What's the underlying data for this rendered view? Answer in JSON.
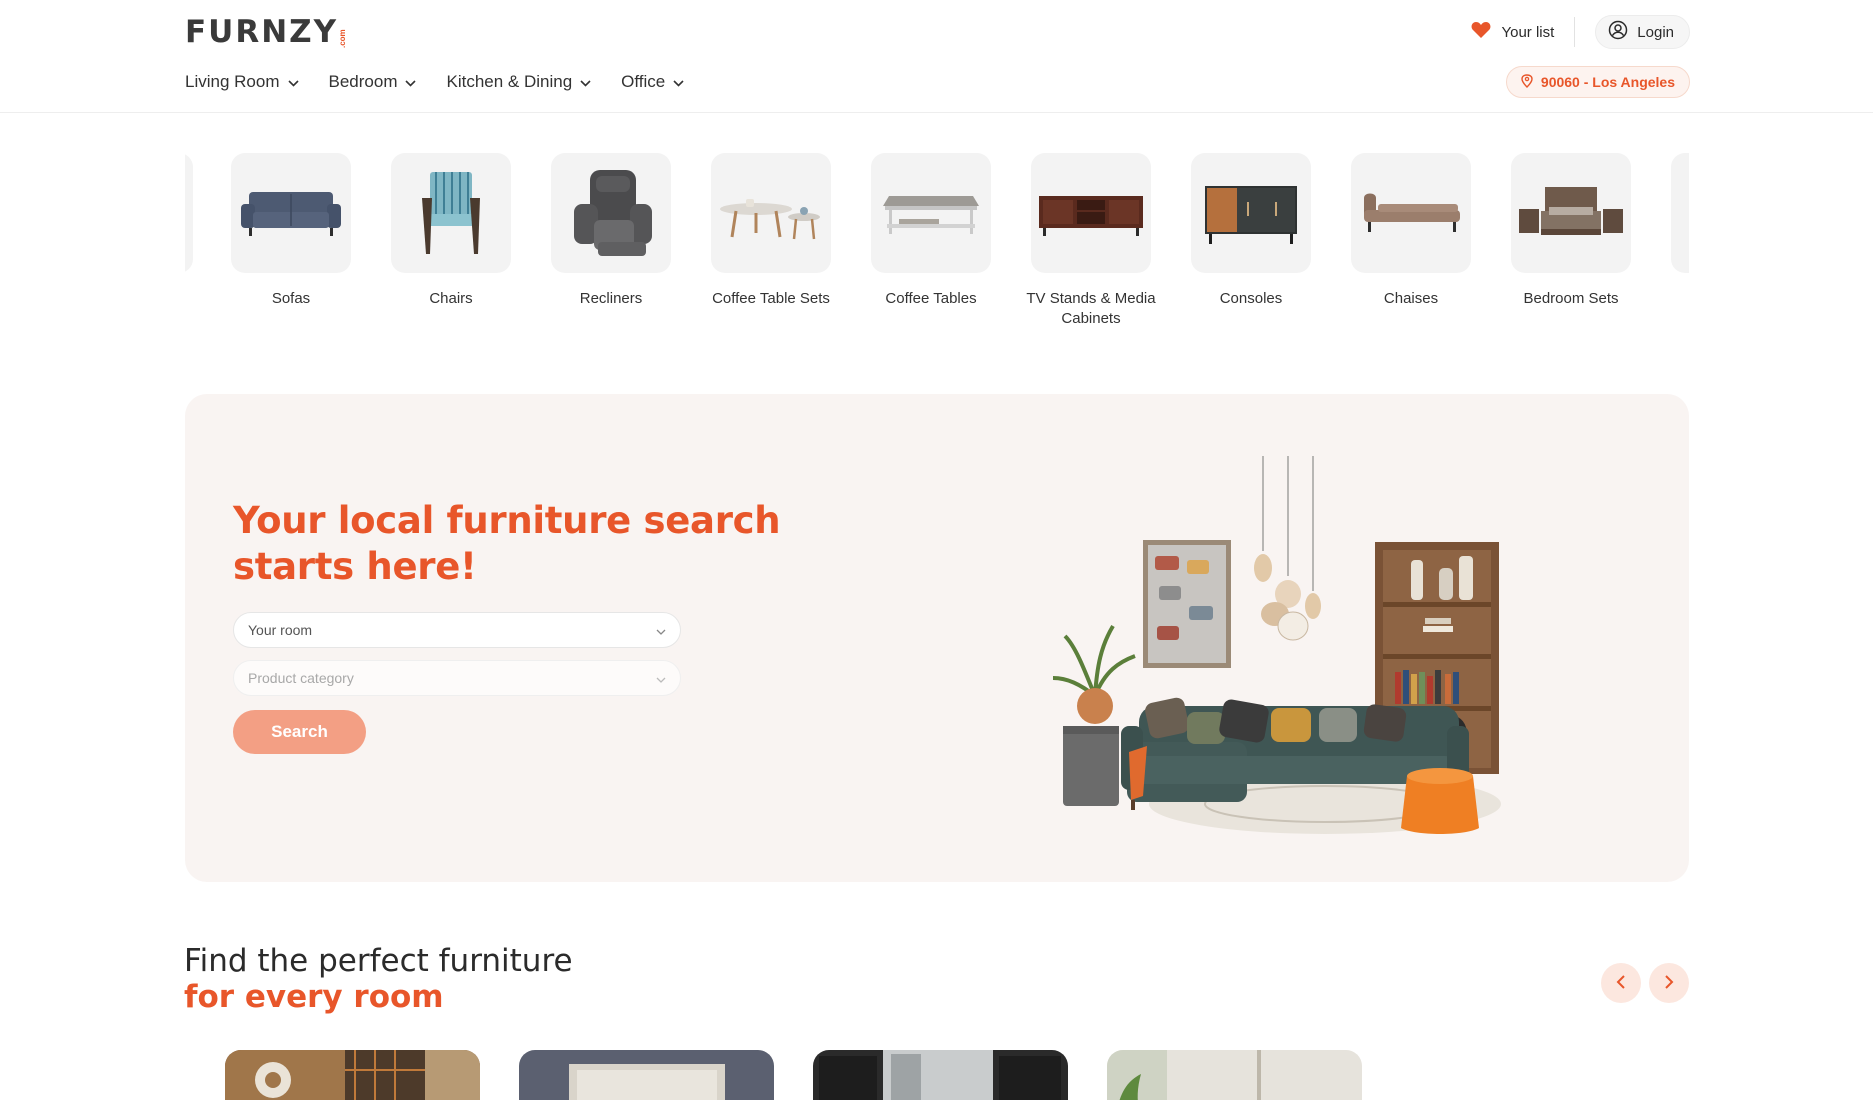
{
  "header": {
    "logo_text": "FURNZY",
    "logo_suffix": ".com",
    "your_list_label": "Your list",
    "login_label": "Login",
    "nav": [
      {
        "label": "Living Room"
      },
      {
        "label": "Bedroom"
      },
      {
        "label": "Kitchen & Dining"
      },
      {
        "label": "Office"
      }
    ],
    "location_label": "90060 - Los Angeles"
  },
  "categories": [
    {
      "label": "Sofas",
      "icon": "sofa-icon"
    },
    {
      "label": "Chairs",
      "icon": "chair-icon"
    },
    {
      "label": "Recliners",
      "icon": "recliner-icon"
    },
    {
      "label": "Coffee Table Sets",
      "icon": "coffee-table-set-icon"
    },
    {
      "label": "Coffee Tables",
      "icon": "coffee-table-icon"
    },
    {
      "label": "TV Stands & Media Cabinets",
      "icon": "tv-stand-icon"
    },
    {
      "label": "Consoles",
      "icon": "console-icon"
    },
    {
      "label": "Chaises",
      "icon": "chaise-icon"
    },
    {
      "label": "Bedroom Sets",
      "icon": "bedroom-set-icon"
    }
  ],
  "hero": {
    "title": "Your local furniture search starts here!",
    "room_placeholder": "Your room",
    "product_placeholder": "Product category",
    "search_label": "Search"
  },
  "rooms_section": {
    "title_line1": "Find the perfect furniture",
    "title_line2": "for every room"
  },
  "colors": {
    "accent": "#e8562a",
    "accent_soft": "#f39f84",
    "hero_bg": "#f9f4f2",
    "thumb_bg": "#f3f3f3"
  }
}
